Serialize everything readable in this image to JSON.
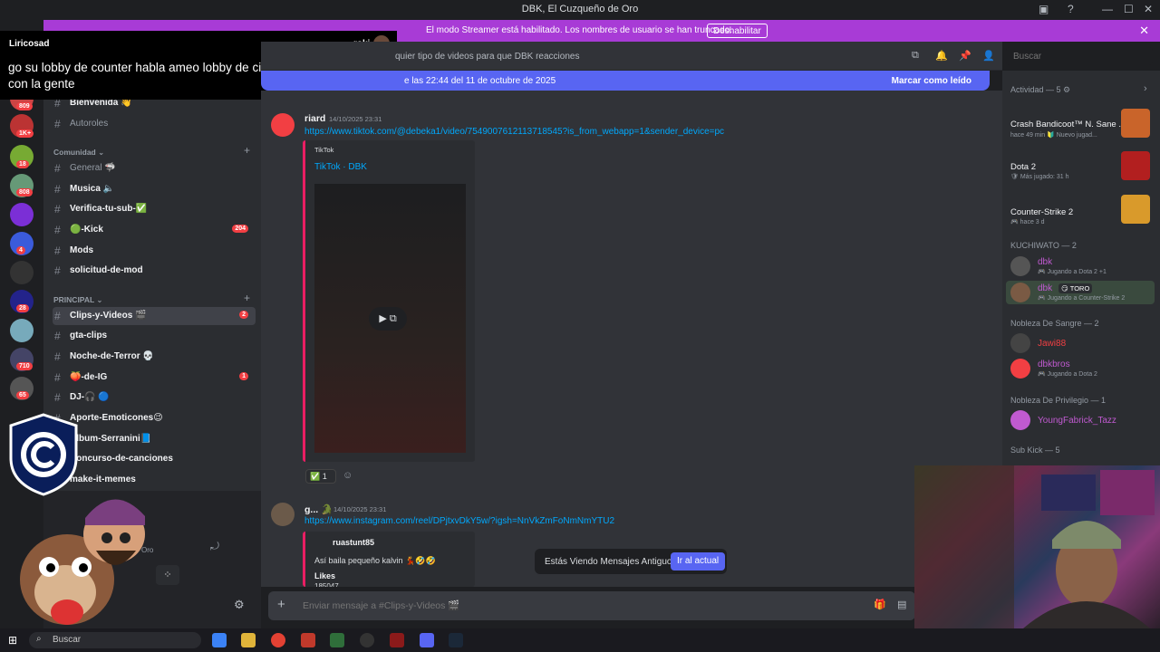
{
  "window": {
    "title": "DBK, El Cuzqueño de Oro"
  },
  "banner": {
    "text": "El modo Streamer está habilitado. Los nombres de usuario se han truncado.",
    "button": "Deshabilitar"
  },
  "overlay": {
    "user": "Liricosad",
    "user2": "roki",
    "message": "go su lobby de counter habla ameo lobby de cincon contra cinco aca con la gente"
  },
  "rail": {
    "badges": [
      "809",
      "1K+",
      "18",
      "808",
      "4",
      "28",
      "710",
      "65"
    ]
  },
  "sidebar": {
    "top_channels": [
      {
        "name": "Bienvenida 👋",
        "bold": true
      },
      {
        "name": "Autoroles",
        "bold": false
      }
    ],
    "categories": [
      {
        "label": "Comunidad ⌄",
        "channels": [
          {
            "name": "General 🦈",
            "bold": false
          },
          {
            "name": "Musica 🔈",
            "bold": true
          },
          {
            "name": "Verifica-tu-sub-✅",
            "bold": true
          },
          {
            "name": "🟢-Kick",
            "bold": true,
            "count": "204"
          },
          {
            "name": "Mods",
            "bold": true
          },
          {
            "name": "solicitud-de-mod",
            "bold": true
          }
        ]
      },
      {
        "label": "PRINCIPAL ⌄",
        "channels": [
          {
            "name": "Clips-y-Videos 🎬",
            "bold": true,
            "active": true,
            "count": "2"
          },
          {
            "name": "gta-clips",
            "bold": true
          },
          {
            "name": "Noche-de-Terror 💀",
            "bold": true
          },
          {
            "name": "🍑-de-IG",
            "bold": true,
            "count": "1"
          },
          {
            "name": "DJ-🎧 🔵",
            "bold": true
          },
          {
            "name": "Aporte-Emoticones😉",
            "bold": true
          },
          {
            "name": "Album-Serranini📘",
            "bold": true
          },
          {
            "name": "Concurso-de-canciones",
            "bold": true
          },
          {
            "name": "make-it-memes",
            "bold": true
          }
        ]
      }
    ],
    "voice_label": "Oro"
  },
  "topbar": {
    "topic": "quier tipo de videos para que DBK reacciones"
  },
  "newbar": {
    "left": "e las 22:44 del 11 de octubre de 2025",
    "right": "Marcar como leído"
  },
  "messages": [
    {
      "author": "riard",
      "time": "14/10/2025 23:31",
      "link": "https://www.tiktok.com/@debeka1/video/7549007612113718545?is_from_webapp=1&sender_device=pc",
      "embed": {
        "provider": "TikTok",
        "title": "TikTok · DBK"
      },
      "reaction_count": "1"
    },
    {
      "author": "g... 🐊",
      "time": "14/10/2025 23:31",
      "link": "https://www.instagram.com/reel/DPjtxvDkY5w/?igsh=NnVkZmFoNmNmYTU2",
      "embed": {
        "author": "ruastunt85",
        "text": "Así baila pequeño kalvin 💃🤣🤣",
        "likes_label": "Likes",
        "likes_value": "185047"
      }
    }
  ],
  "toast": {
    "text": "Estás Viendo Mensajes Antiguos",
    "button": "Ir al actual"
  },
  "composer": {
    "placeholder": "Enviar mensaje a #Clips-y-Videos 🎬"
  },
  "search": {
    "placeholder": "Buscar"
  },
  "right_sidebar": {
    "activity_header": "Actividad — 5 ⚙",
    "activities": [
      {
        "title": "Crash Bandicoot™ N. Sane ...",
        "sub": "hace 49 min  🔰 Nuevo jugad..."
      },
      {
        "title": "Dota 2",
        "sub": "🛡 Más jugado: 31 h"
      },
      {
        "title": "Counter-Strike 2",
        "sub": "🎮 hace 3 d"
      }
    ],
    "groups": [
      {
        "label": "KUCHIWATO — 2",
        "members": [
          {
            "name": "dbk",
            "sub": "🎮 Jugando a Dota 2 +1"
          },
          {
            "name": "dbk",
            "tag": "😏 TORO",
            "sub": "🎮 Jugando a Counter-Strike 2"
          }
        ]
      },
      {
        "label": "Nobleza De Sangre — 2",
        "members": [
          {
            "name": "Jawi88",
            "sub": ""
          },
          {
            "name": "dbkbros",
            "sub": "🎮 Jugando a Dota 2"
          }
        ]
      },
      {
        "label": "Nobleza De Privilegio — 1",
        "members": [
          {
            "name": "YoungFabrick_Tazz",
            "sub": ""
          }
        ]
      },
      {
        "label": "Sub Kick — 5",
        "members": []
      }
    ]
  },
  "taskbar": {
    "search_placeholder": "Buscar"
  },
  "colors": {
    "accent": "#5865f2",
    "streamer": "#a83bd6",
    "mention": "#f23f43"
  }
}
